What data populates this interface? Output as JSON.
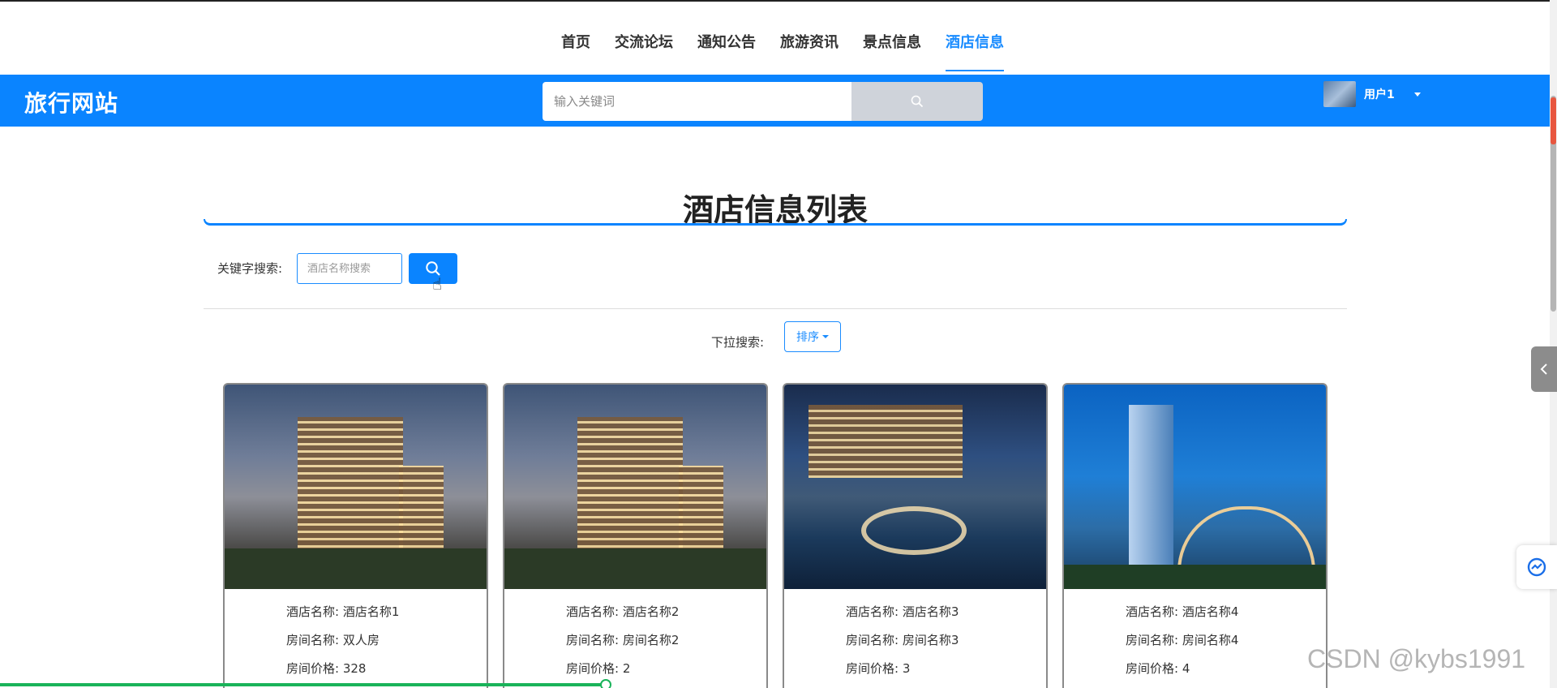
{
  "nav": {
    "items": [
      {
        "label": "首页"
      },
      {
        "label": "交流论坛"
      },
      {
        "label": "通知公告"
      },
      {
        "label": "旅游资讯"
      },
      {
        "label": "景点信息"
      },
      {
        "label": "酒店信息",
        "active": true
      }
    ]
  },
  "header": {
    "site_title": "旅行网站",
    "search_placeholder": "输入关键词",
    "search_icon": "search-icon",
    "user_name": "用户1",
    "user_caret_icon": "caret-down-icon"
  },
  "main": {
    "list_title": "酒店信息列表",
    "keyword_label": "关键字搜索:",
    "keyword_placeholder": "酒店名称搜索",
    "dropdown_label": "下拉搜索:",
    "sort_label": "排序"
  },
  "cards": [
    {
      "name_label": "酒店名称:",
      "name": "酒店名称1",
      "room_label": "房间名称:",
      "room": "双人房",
      "price_label": "房间价格:",
      "price": "328"
    },
    {
      "name_label": "酒店名称:",
      "name": "酒店名称2",
      "room_label": "房间名称:",
      "room": "房间名称2",
      "price_label": "房间价格:",
      "price": "2"
    },
    {
      "name_label": "酒店名称:",
      "name": "酒店名称3",
      "room_label": "房间名称:",
      "room": "房间名称3",
      "price_label": "房间价格:",
      "price": "3"
    },
    {
      "name_label": "酒店名称:",
      "name": "酒店名称4",
      "room_label": "房间名称:",
      "room": "房间名称4",
      "price_label": "房间价格:",
      "price": "4"
    }
  ],
  "watermark": "CSDN @kybs1991",
  "colors": {
    "accent": "#0a84ff",
    "nav_active": "#1a8cff",
    "progress": "#1ab35a"
  }
}
